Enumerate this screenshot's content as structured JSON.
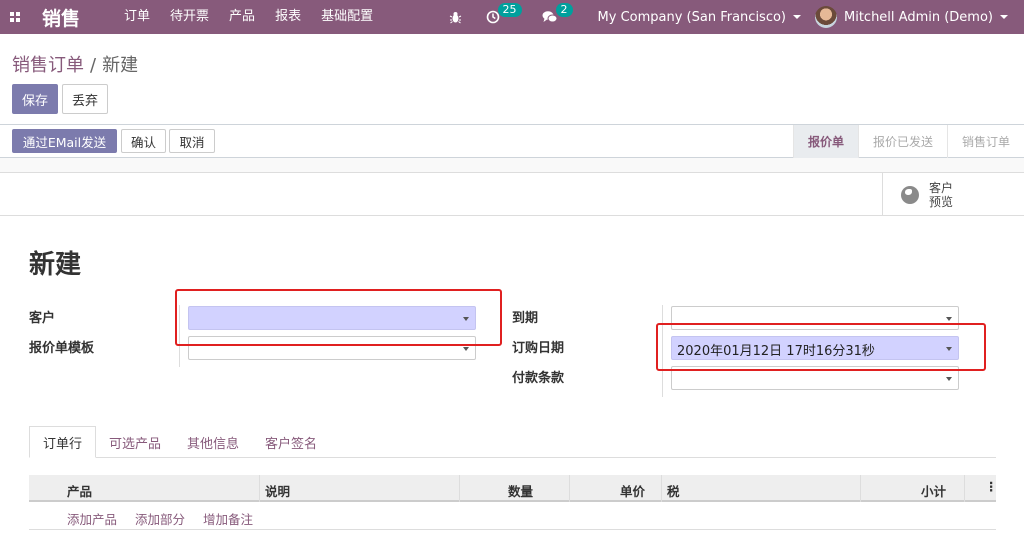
{
  "navbar": {
    "brand": "销售",
    "menu": [
      "订单",
      "待开票",
      "产品",
      "报表",
      "基础配置"
    ],
    "activity_count": "25",
    "messages_count": "2",
    "company": "My Company (San Francisco)",
    "user": "Mitchell Admin (Demo)",
    "color": "#875a7b"
  },
  "breadcrumb": {
    "parent": "销售订单",
    "current": "新建"
  },
  "actions": {
    "save": "保存",
    "discard": "丢弃"
  },
  "statusbar": {
    "send_email": "通过EMail发送",
    "confirm": "确认",
    "cancel": "取消",
    "stages": [
      "报价单",
      "报价已发送",
      "销售订单"
    ],
    "active_stage": "报价单"
  },
  "button_box": {
    "preview_line1": "客户",
    "preview_line2": "预览"
  },
  "form": {
    "title": "新建",
    "customer_label": "客户",
    "customer_value": "",
    "template_label": "报价单模板",
    "template_value": "",
    "validity_label": "到期",
    "validity_value": "",
    "order_date_label": "订购日期",
    "order_date_value": "2020年01月12日 17时16分31秒",
    "payment_terms_label": "付款条款",
    "payment_terms_value": ""
  },
  "tabs": [
    "订单行",
    "可选产品",
    "其他信息",
    "客户签名"
  ],
  "order_lines": {
    "columns": [
      "产品",
      "说明",
      "数量",
      "单价",
      "税",
      "小计"
    ],
    "add_product": "添加产品",
    "add_section": "添加部分",
    "add_note": "增加备注"
  }
}
